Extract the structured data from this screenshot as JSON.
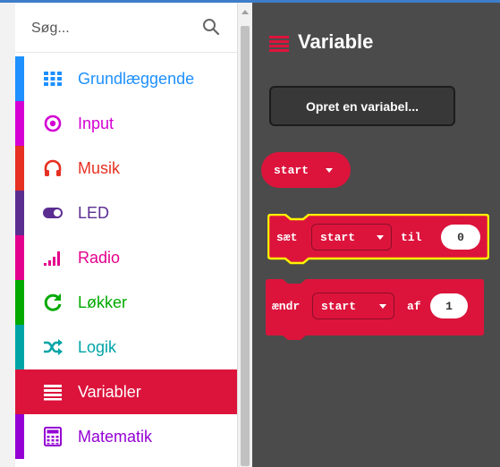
{
  "search": {
    "placeholder": "Søg..."
  },
  "categories": [
    {
      "label": "Grundlæggende",
      "color": "#1e90ff",
      "icon": "grid-icon"
    },
    {
      "label": "Input",
      "color": "#d400d4",
      "icon": "target-icon"
    },
    {
      "label": "Musik",
      "color": "#e63022",
      "icon": "headphones-icon"
    },
    {
      "label": "LED",
      "color": "#5c2d91",
      "icon": "toggle-icon"
    },
    {
      "label": "Radio",
      "color": "#e3008c",
      "icon": "signal-bars-icon"
    },
    {
      "label": "Løkker",
      "color": "#00aa00",
      "icon": "refresh-icon"
    },
    {
      "label": "Logik",
      "color": "#00a4a6",
      "icon": "shuffle-icon"
    },
    {
      "label": "Variabler",
      "color": "#dc143c",
      "icon": "list-icon",
      "selected": true
    },
    {
      "label": "Matematik",
      "color": "#9400d3",
      "icon": "calculator-icon"
    }
  ],
  "flyout": {
    "title": "Variable",
    "make_variable_label": "Opret en variabel...",
    "var_block": {
      "name": "start"
    },
    "set_block": {
      "keyword": "sæt",
      "var": "start",
      "connector": "til",
      "value": "0"
    },
    "change_block": {
      "keyword": "ændr",
      "var": "start",
      "connector": "af",
      "value": "1"
    }
  },
  "colors": {
    "accent_blue": "#3d7dca",
    "variable_red": "#dc143c",
    "selected_block_outline": "#fff200",
    "workspace_bg": "#4b4b4b"
  }
}
